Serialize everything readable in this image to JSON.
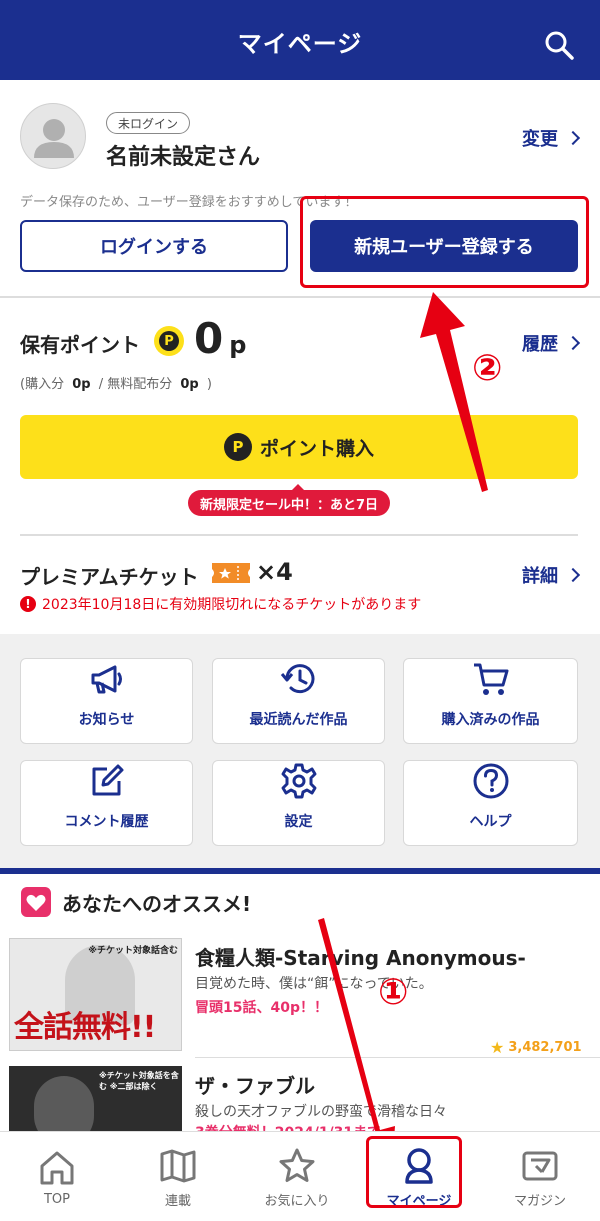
{
  "header": {
    "title": "マイページ"
  },
  "profile": {
    "badge": "未ログイン",
    "name": "名前未設定さん",
    "change_label": "変更",
    "notice": "データ保存のため、ユーザー登録をおすすめしています！",
    "login_label": "ログインする",
    "register_label": "新規ユーザー登録する"
  },
  "points": {
    "label": "保有ポイント",
    "coin": "P",
    "value": "0",
    "unit": "p",
    "history_label": "履歴",
    "breakdown_prefix": "(購入分",
    "purchased": "0p",
    "separator": "/ 無料配布分",
    "free": "0p",
    "breakdown_suffix": ")",
    "buy_label": "ポイント購入",
    "sale_badge": "新規限定セール中！：あと7日"
  },
  "ticket": {
    "label": "プレミアムチケット",
    "count": "×4",
    "detail_label": "詳細",
    "warning": "2023年10月18日に有効期限切れになるチケットがあります"
  },
  "menu": [
    {
      "label": "お知らせ",
      "icon": "megaphone-icon"
    },
    {
      "label": "最近読んだ作品",
      "icon": "history-icon"
    },
    {
      "label": "購入済みの作品",
      "icon": "cart-icon"
    },
    {
      "label": "コメント履歴",
      "icon": "edit-icon"
    },
    {
      "label": "設定",
      "icon": "gear-icon"
    },
    {
      "label": "ヘルプ",
      "icon": "help-icon"
    }
  ],
  "recommend": {
    "title": "あなたへのオススメ!",
    "items": [
      {
        "thumb_note": "※チケット対象話含む",
        "thumb_text": "全話無料!!",
        "title": "食糧人類-Starving Anonymous-",
        "desc": "目覚めた時、僕は“餌”になっていた。",
        "promo": "冒頭15話、40p！！",
        "likes": "3,482,701"
      },
      {
        "thumb_note": "※チケット対象話を含む ※二部は除く",
        "title": "ザ・ファブル",
        "desc": "殺しの天才ファブルの野蛮で滑稽な日々",
        "promo": "3巻分無料！2024/1/31まで"
      }
    ]
  },
  "annotations": {
    "step1": "①",
    "step2": "②"
  },
  "nav": [
    {
      "label": "TOP",
      "icon": "home-icon"
    },
    {
      "label": "連載",
      "icon": "book-icon"
    },
    {
      "label": "お気に入り",
      "icon": "star-icon"
    },
    {
      "label": "マイページ",
      "icon": "user-icon",
      "active": true
    },
    {
      "label": "マガジン",
      "icon": "magazine-icon"
    }
  ],
  "colors": {
    "brand": "#1b2f8f",
    "accent_yellow": "#fde01a",
    "alert_red": "#e60012",
    "ticket_orange": "#f28c28"
  }
}
